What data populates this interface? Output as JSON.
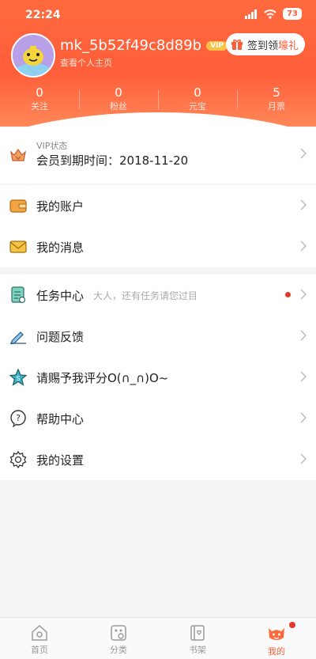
{
  "status_bar": {
    "time": "22:24",
    "battery": "73"
  },
  "profile": {
    "username": "mk_5b52f49c8d89b",
    "vip_badge": "VIP",
    "subtitle": "查看个人主页",
    "signin_label": "签到领",
    "signin_accent": "壕礼"
  },
  "stats": [
    {
      "value": "0",
      "label": "关注"
    },
    {
      "value": "0",
      "label": "粉丝"
    },
    {
      "value": "0",
      "label": "元宝"
    },
    {
      "value": "5",
      "label": "月票"
    }
  ],
  "vip": {
    "status_label": "VIP状态",
    "expire_text": "会员到期时间：2018-11-20"
  },
  "menu": {
    "account": "我的账户",
    "messages": "我的消息",
    "tasks": "任务中心",
    "tasks_hint": "大人，还有任务请您过目",
    "feedback": "问题反馈",
    "rate": "请赐予我评分O(∩_∩)O~",
    "help": "帮助中心",
    "settings": "我的设置"
  },
  "tabs": [
    {
      "label": "首页"
    },
    {
      "label": "分类"
    },
    {
      "label": "书架"
    },
    {
      "label": "我的"
    }
  ],
  "colors": {
    "accent": "#ff5e3a",
    "header": "#ff6a3d",
    "badge": "#f6c346",
    "notify": "#e23b2e"
  }
}
